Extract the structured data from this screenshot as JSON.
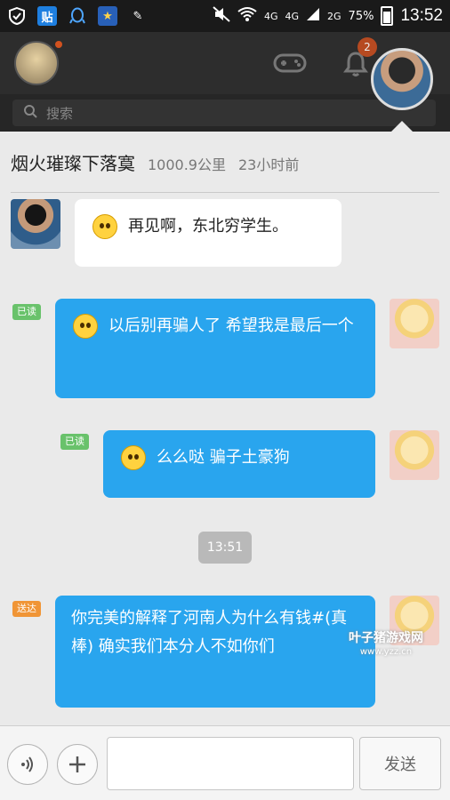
{
  "status_bar": {
    "icons": [
      "shield-icon",
      "tieba-icon",
      "qq-icon",
      "star-app-icon",
      "pen-icon",
      "mute-icon",
      "wifi-icon",
      "signal-icon",
      "battery-icon"
    ],
    "tieba_glyph": "贴",
    "net1": "4G",
    "net2": "4G",
    "net3": "2G",
    "battery": "75%",
    "time": "13:52"
  },
  "header": {
    "notification_count": "2",
    "search_placeholder": "搜索"
  },
  "chat": {
    "contact_name": "烟火璀璨下落寞",
    "distance": "1000.9公里",
    "last_seen": "23小时前",
    "messages": [
      {
        "direction": "in",
        "text": "再见啊，东北穷学生。",
        "status": ""
      },
      {
        "direction": "out",
        "text": "以后别再骗人了   希望我是最后一个",
        "status": "已读"
      },
      {
        "direction": "out",
        "text": "么么哒   骗子土豪狗",
        "status": "已读"
      },
      {
        "direction": "out",
        "text": "你完美的解释了河南人为什么有钱#(真棒)     确实我们本分人不如你们",
        "status": "送达"
      }
    ],
    "time_divider": "13:51"
  },
  "input_bar": {
    "input_value": "",
    "send_label": "发送"
  },
  "watermark": {
    "line1": "叶子猪游戏网",
    "line2": "www.yzz.cn"
  },
  "colors": {
    "outgoing_bubble": "#29a5ee",
    "incoming_bubble": "#ffffff",
    "read_tag": "#69c26b",
    "sent_tag": "#f09536"
  }
}
